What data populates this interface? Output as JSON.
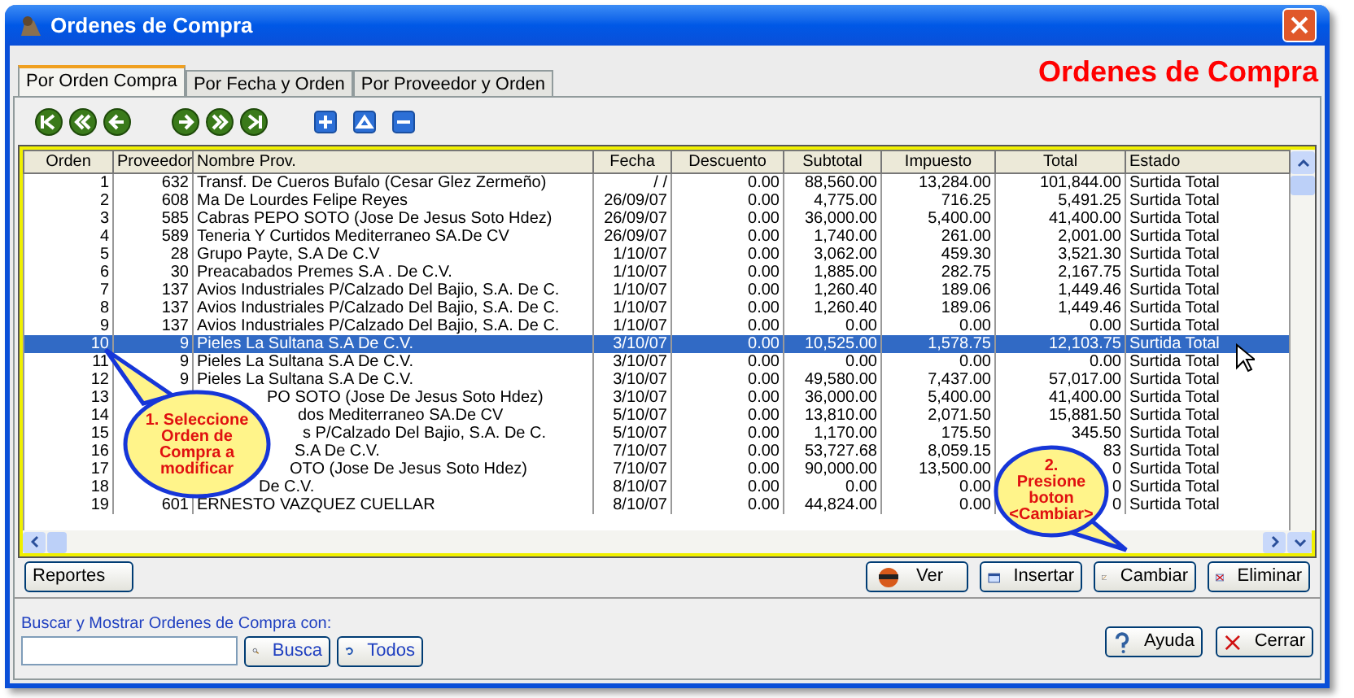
{
  "window": {
    "title": "Ordenes de Compra"
  },
  "heading": "Ordenes de Compra",
  "tabs": [
    {
      "label": "Por Orden Compra",
      "selected": true
    },
    {
      "label": "Por Fecha y Orden",
      "selected": false
    },
    {
      "label": "Por Proveedor y Orden",
      "selected": false
    }
  ],
  "table": {
    "columns": [
      "Orden",
      "Proveedor",
      "Nombre Prov.",
      "Fecha",
      "Descuento",
      "Subtotal",
      "Impuesto",
      "Total",
      "Estado"
    ],
    "rows": [
      {
        "orden": "1",
        "proveedor": "632",
        "nombre": "Transf. De Cueros Bufalo (Cesar Glez Zermeño)",
        "fecha": "/ /",
        "descuento": "0.00",
        "subtotal": "88,560.00",
        "impuesto": "13,284.00",
        "total": "101,844.00",
        "estado": "Surtida Total",
        "selected": false
      },
      {
        "orden": "2",
        "proveedor": "608",
        "nombre": "Ma De Lourdes Felipe Reyes",
        "fecha": "26/09/07",
        "descuento": "0.00",
        "subtotal": "4,775.00",
        "impuesto": "716.25",
        "total": "5,491.25",
        "estado": "Surtida Total",
        "selected": false
      },
      {
        "orden": "3",
        "proveedor": "585",
        "nombre": "Cabras PEPO SOTO (Jose De Jesus Soto Hdez)",
        "fecha": "26/09/07",
        "descuento": "0.00",
        "subtotal": "36,000.00",
        "impuesto": "5,400.00",
        "total": "41,400.00",
        "estado": "Surtida Total",
        "selected": false
      },
      {
        "orden": "4",
        "proveedor": "589",
        "nombre": "Teneria Y Curtidos Mediterraneo SA.De CV",
        "fecha": "26/09/07",
        "descuento": "0.00",
        "subtotal": "1,740.00",
        "impuesto": "261.00",
        "total": "2,001.00",
        "estado": "Surtida Total",
        "selected": false
      },
      {
        "orden": "5",
        "proveedor": "28",
        "nombre": "Grupo Payte, S.A De C.V",
        "fecha": "1/10/07",
        "descuento": "0.00",
        "subtotal": "3,062.00",
        "impuesto": "459.30",
        "total": "3,521.30",
        "estado": "Surtida Total",
        "selected": false
      },
      {
        "orden": "6",
        "proveedor": "30",
        "nombre": "Preacabados Premes S.A . De C.V.",
        "fecha": "1/10/07",
        "descuento": "0.00",
        "subtotal": "1,885.00",
        "impuesto": "282.75",
        "total": "2,167.75",
        "estado": "Surtida Total",
        "selected": false
      },
      {
        "orden": "7",
        "proveedor": "137",
        "nombre": "Avios Industriales P/Calzado Del Bajio, S.A. De C.",
        "fecha": "1/10/07",
        "descuento": "0.00",
        "subtotal": "1,260.40",
        "impuesto": "189.06",
        "total": "1,449.46",
        "estado": "Surtida Total",
        "selected": false
      },
      {
        "orden": "8",
        "proveedor": "137",
        "nombre": "Avios Industriales P/Calzado Del Bajio, S.A. De C.",
        "fecha": "1/10/07",
        "descuento": "0.00",
        "subtotal": "1,260.40",
        "impuesto": "189.06",
        "total": "1,449.46",
        "estado": "Surtida Total",
        "selected": false
      },
      {
        "orden": "9",
        "proveedor": "137",
        "nombre": "Avios Industriales P/Calzado Del Bajio, S.A. De C.",
        "fecha": "1/10/07",
        "descuento": "0.00",
        "subtotal": "0.00",
        "impuesto": "0.00",
        "total": "0.00",
        "estado": "Surtida Total",
        "selected": false
      },
      {
        "orden": "10",
        "proveedor": "9",
        "nombre": "Pieles La Sultana S.A  De C.V.",
        "fecha": "3/10/07",
        "descuento": "0.00",
        "subtotal": "10,525.00",
        "impuesto": "1,578.75",
        "total": "12,103.75",
        "estado": "Surtida Total",
        "selected": true
      },
      {
        "orden": "11",
        "proveedor": "9",
        "nombre": "Pieles La Sultana S.A  De C.V.",
        "fecha": "3/10/07",
        "descuento": "0.00",
        "subtotal": "0.00",
        "impuesto": "0.00",
        "total": "0.00",
        "estado": "Surtida Total",
        "selected": false
      },
      {
        "orden": "12",
        "proveedor": "9",
        "nombre": "Pieles La Sultana S.A  De C.V.",
        "fecha": "3/10/07",
        "descuento": "0.00",
        "subtotal": "49,580.00",
        "impuesto": "7,437.00",
        "total": "57,017.00",
        "estado": "Surtida Total",
        "selected": false
      },
      {
        "orden": "13",
        "nombre": "PO SOTO (Jose De Jesus Soto Hdez)",
        "fecha": "3/10/07",
        "descuento": "0.00",
        "subtotal": "36,000.00",
        "impuesto": "5,400.00",
        "total": "41,400.00",
        "estado": "Surtida Total",
        "selected": false
      },
      {
        "orden": "14",
        "nombre": "dos Mediterraneo SA.De CV",
        "fecha": "5/10/07",
        "descuento": "0.00",
        "subtotal": "13,810.00",
        "impuesto": "2,071.50",
        "total": "15,881.50",
        "estado": "Surtida Total",
        "selected": false
      },
      {
        "orden": "15",
        "nombre": "s P/Calzado Del Bajio, S.A. De C.",
        "fecha": "5/10/07",
        "descuento": "0.00",
        "subtotal": "1,170.00",
        "impuesto": "175.50",
        "total": "345.50",
        "estado": "Surtida Total",
        "selected": false
      },
      {
        "orden": "16",
        "nombre": "S.A De C.V.",
        "fecha": "7/10/07",
        "descuento": "0.00",
        "subtotal": "53,727.68",
        "impuesto": "8,059.15",
        "total": "83",
        "estado": "Surtida Total",
        "selected": false
      },
      {
        "orden": "17",
        "nombre": "OTO (Jose De Jesus Soto Hdez)",
        "fecha": "7/10/07",
        "descuento": "0.00",
        "subtotal": "90,000.00",
        "impuesto": "13,500.00",
        "total": "0",
        "estado": "Surtida Total",
        "selected": false
      },
      {
        "orden": "18",
        "nombre": "De C.V.",
        "fecha": "8/10/07",
        "descuento": "0.00",
        "subtotal": "0.00",
        "impuesto": "0.00",
        "total": "0",
        "estado": "Surtida Total",
        "selected": false
      },
      {
        "orden": "19",
        "proveedor": "601",
        "nombre": "ERNESTO VAZQUEZ CUELLAR",
        "fecha": "8/10/07",
        "descuento": "0.00",
        "subtotal": "44,824.00",
        "impuesto": "0.00",
        "total": "0",
        "estado": "Surtida Total",
        "selected": false
      }
    ]
  },
  "callouts": [
    {
      "lines": [
        "1. Seleccione",
        "Orden de",
        "Compra a",
        "modificar"
      ]
    },
    {
      "lines": [
        "2.",
        "Presione",
        "boton",
        "<Cambiar>"
      ]
    }
  ],
  "action_buttons": [
    {
      "kind": "ver",
      "label": "Ver"
    },
    {
      "kind": "insertar",
      "label": "Insertar"
    },
    {
      "kind": "cambiar",
      "label": "Cambiar"
    },
    {
      "kind": "eliminar",
      "label": "Eliminar"
    }
  ],
  "reportes_button": "Reportes",
  "search": {
    "label": "Buscar y Mostrar Ordenes de Compra con:",
    "buttons": [
      {
        "kind": "busca",
        "label": "Busca"
      },
      {
        "kind": "todos",
        "label": "Todos"
      }
    ]
  },
  "footer_buttons": [
    {
      "kind": "ayuda",
      "label": "Ayuda"
    },
    {
      "kind": "cerrar",
      "label": "Cerrar"
    }
  ]
}
